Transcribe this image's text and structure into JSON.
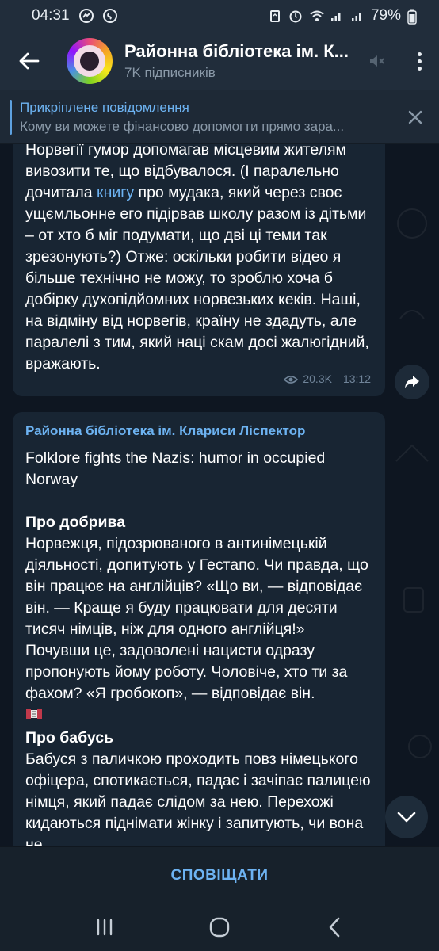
{
  "status_bar": {
    "time": "04:31",
    "battery": "79%"
  },
  "header": {
    "title": "Районна бібліотека ім. К...",
    "subscribers": "7K підписників"
  },
  "pinned": {
    "label": "Прикріплене повідомлення",
    "text": "Кому ви можете фінансово допомогти прямо зара..."
  },
  "message1": {
    "lines_before_link": "Норвегії гумор допомагав місцевим жителям вивозити те, що відбувалося. (І паралельно дочитала ",
    "link": "книгу",
    "lines_after_link": " про мудака, який через своє ущємльонне его підірвав школу разом із дітьми – от хто б міг подумати, що дві ці теми так зрезонують?) Отже: оскільки робити відео я більше технічно не можу, то зроблю хоча б добірку духопідйомних норвезьких кеків. Наші, на відміну від норвегів, країну не здадуть, але паралелі з тим, який наці скам досі жалюгідний, вражають.",
    "views": "20.3K",
    "time": "13:12"
  },
  "message2": {
    "author": "Районна бібліотека ім. Клариси Ліспектор",
    "title": "Folklore fights the Nazis: humor in occupied Norway",
    "section1_title": "Про добрива",
    "section1_text": "Норвежця, підозрюваного в антинімецькій діяльності, допитують у Гестапо. Чи правда, що він працює на англійців? «Що ви, — відповідає він. — Краще я буду працювати для десяти тисяч німців, ніж для одного англійця!» Почувши це, задоволені нацисти одразу пропонують йому роботу. Чоловіче, хто ти за фахом? «Я гробокоп», — відповідає він.",
    "section1_emoji": "accordion-emoji",
    "section2_title": "Про бабусь",
    "section2_text": "Бабуся з паличкою проходить повз німецького офіцера, спотикається, падає і зачіпає палицею німця, який падає слідом за нею. Перехожі кидаються піднімати жінку і запитують, чи вона не"
  },
  "bottom": {
    "notify_label": "СПОВІЩАТИ"
  },
  "colors": {
    "accent": "#6db3f2",
    "bubble": "#182533",
    "chat_bg": "#0e1621",
    "header_bg": "#212d3b"
  }
}
